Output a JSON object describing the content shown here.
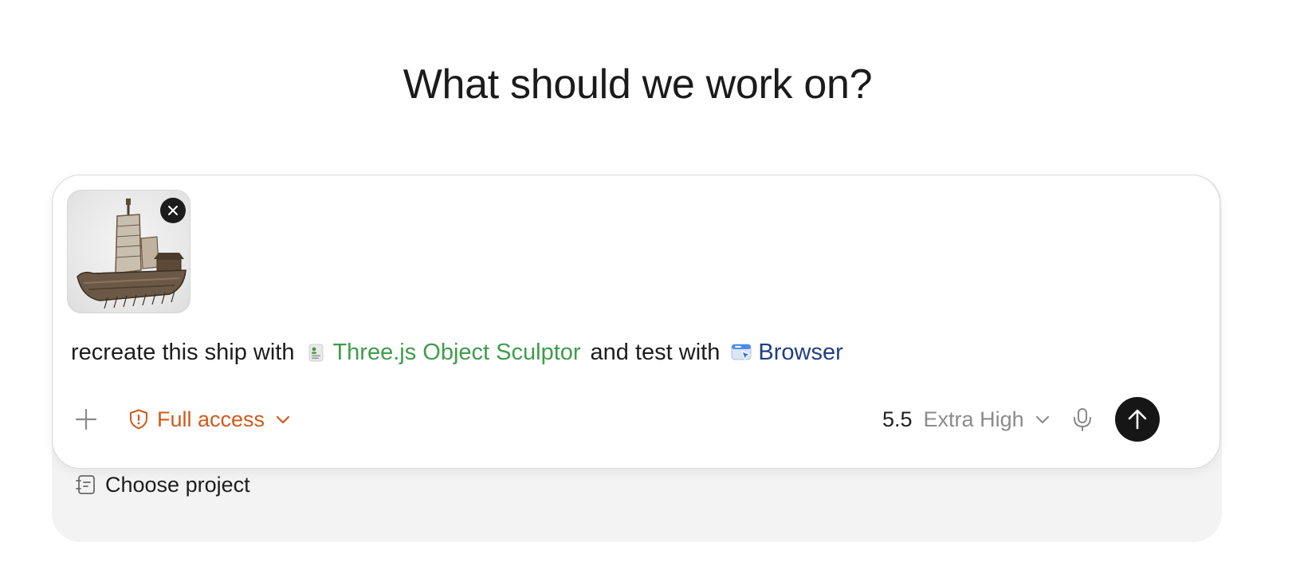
{
  "heading": "What should we work on?",
  "composer": {
    "attachment": {
      "icon": "image-thumbnail"
    },
    "prompt": {
      "text_before": "recreate this ship with",
      "skill_chip": "Three.js Object Sculptor",
      "text_middle": "and test with",
      "browser_chip": "Browser"
    },
    "toolbar": {
      "access_label": "Full access",
      "model_version": "5.5",
      "model_level": "Extra High"
    }
  },
  "footer": {
    "project_label": "Choose project"
  },
  "colors": {
    "access": "#cf5a1c",
    "skill": "#3f9c4b",
    "browser": "#1e3f86",
    "send_button": "#161616"
  }
}
